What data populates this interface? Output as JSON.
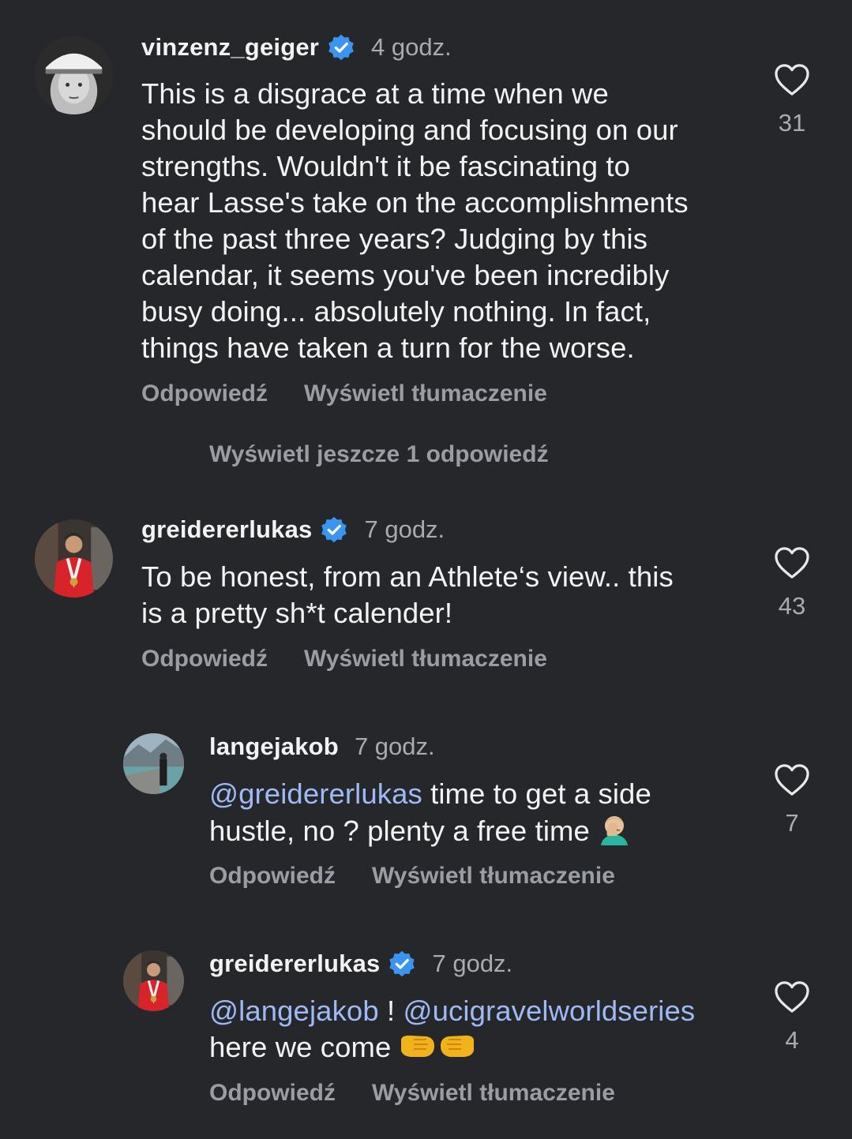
{
  "comments": [
    {
      "username": "vinzenz_geiger",
      "verified": true,
      "time": "4 godz.",
      "lines": [
        "This is a disgrace at a time when we",
        "should be developing and focusing on our",
        "strengths. Wouldn't it be fascinating to",
        "hear Lasse's take on the accomplishments",
        "of the past three years? Judging by this",
        "calendar, it seems you've been incredibly",
        "busy doing... absolutely nothing. In fact,",
        "things have taken a turn for the worse."
      ],
      "reply_label": "Odpowiedź",
      "translate_label": "Wyświetl tłumaczenie",
      "likes": "31"
    },
    {
      "username": "greidererlukas",
      "verified": true,
      "time": "7 godz.",
      "lines": [
        "To be honest, from an Athlete‘s view.. this",
        "is a pretty sh*t calender!"
      ],
      "reply_label": "Odpowiedź",
      "translate_label": "Wyświetl tłumaczenie",
      "likes": "43"
    },
    {
      "username": "langejakob",
      "verified": false,
      "time": "7 godz.",
      "mention": "@greidererlukas",
      "line1_rest": " time to get a side",
      "line2": "hustle, no ? plenty a free time ",
      "emoji": "facepalm",
      "reply_label": "Odpowiedź",
      "translate_label": "Wyświetl tłumaczenie",
      "likes": "7"
    },
    {
      "username": "greidererlukas",
      "verified": true,
      "time": "7 godz.",
      "mention1": "@langejakob",
      "sep": " ! ",
      "mention2": "@ucigravelworldseries",
      "line2": "here we come ",
      "emoji": "fist-bump",
      "reply_label": "Odpowiedź",
      "translate_label": "Wyświetl tłumaczenie",
      "likes": "4"
    }
  ],
  "more_replies": "Wyświetl jeszcze 1 odpowiedź",
  "colors": {
    "background": "#25272b",
    "text": "#f3f3f3",
    "secondary": "#a9abb0",
    "mention": "#9fb9f5",
    "verified": "#3b94f0"
  }
}
